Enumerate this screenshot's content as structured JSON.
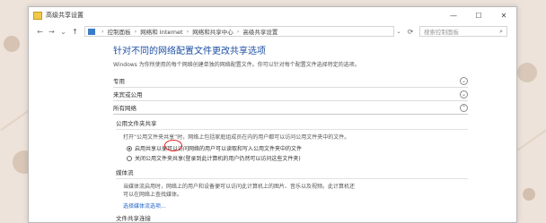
{
  "window": {
    "title": "高级共享设置",
    "controls": {
      "minimize": "—",
      "maximize": "☐",
      "close": "✕"
    }
  },
  "address": {
    "back": "←",
    "forward": "→",
    "recent": "⌄",
    "up": "↑",
    "crumbs": [
      "控制面板",
      "网络和 Internet",
      "网络和共享中心",
      "高级共享设置"
    ],
    "search_placeholder": "搜索控制面板"
  },
  "content": {
    "heading": "针对不同的网络配置文件更改共享选项",
    "intro": "Windows 为你所使用的每个网络创建单独的网络配置文件。你可以针对每个配置文件选择特定的选项。",
    "profiles": [
      {
        "label": "专用"
      },
      {
        "label": "来宾或公用"
      },
      {
        "label": "所有网络"
      }
    ],
    "public_folder": {
      "title": "公用文件夹共享",
      "desc": "打开“公用文件夹共享”时，网络上包括家庭组成员在内的用户都可以访问公用文件夹中的文件。",
      "options": [
        {
          "label": "启用共享以便可以访问网络的用户可以读取和写入公用文件夹中的文件",
          "checked": true
        },
        {
          "label": "关闭公用文件夹共享(登录到此计算机的用户仍然可以访问这些文件夹)",
          "checked": false
        }
      ]
    },
    "media": {
      "title": "媒体流",
      "desc1": "当媒体流启用时，网络上的用户和设备便可以访问此计算机上的图片、音乐以及视频。此计算机还",
      "desc2": "可以在网络上查找媒体。",
      "link": "选择媒体流选项..."
    },
    "next_section": "文件共享连接"
  }
}
